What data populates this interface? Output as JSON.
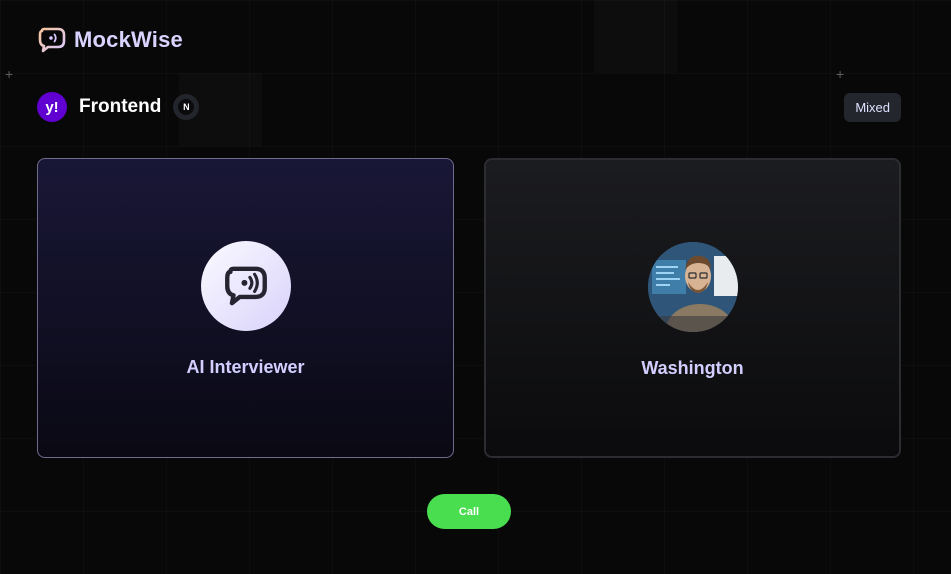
{
  "brand": {
    "name": "MockWise",
    "logo_icon": "chat-bubble-signal-icon"
  },
  "interview": {
    "company_logo_text": "y!",
    "company_logo_color": "#6001d2",
    "role": "Frontend",
    "tech_stack": [
      {
        "icon": "nextjs-icon",
        "glyph": "N"
      }
    ],
    "type": "Mixed"
  },
  "participants": {
    "interviewer": {
      "name": "AI Interviewer",
      "icon": "chat-bubble-signal-icon"
    },
    "user": {
      "name": "Washington",
      "icon": "user-avatar-photo"
    }
  },
  "actions": {
    "call_label": "Call",
    "call_color": "#49de50"
  },
  "colors": {
    "background": "#080808",
    "accent": "#d2ceff",
    "ai_card": "#191736",
    "user_card": "#1b1c1f"
  }
}
